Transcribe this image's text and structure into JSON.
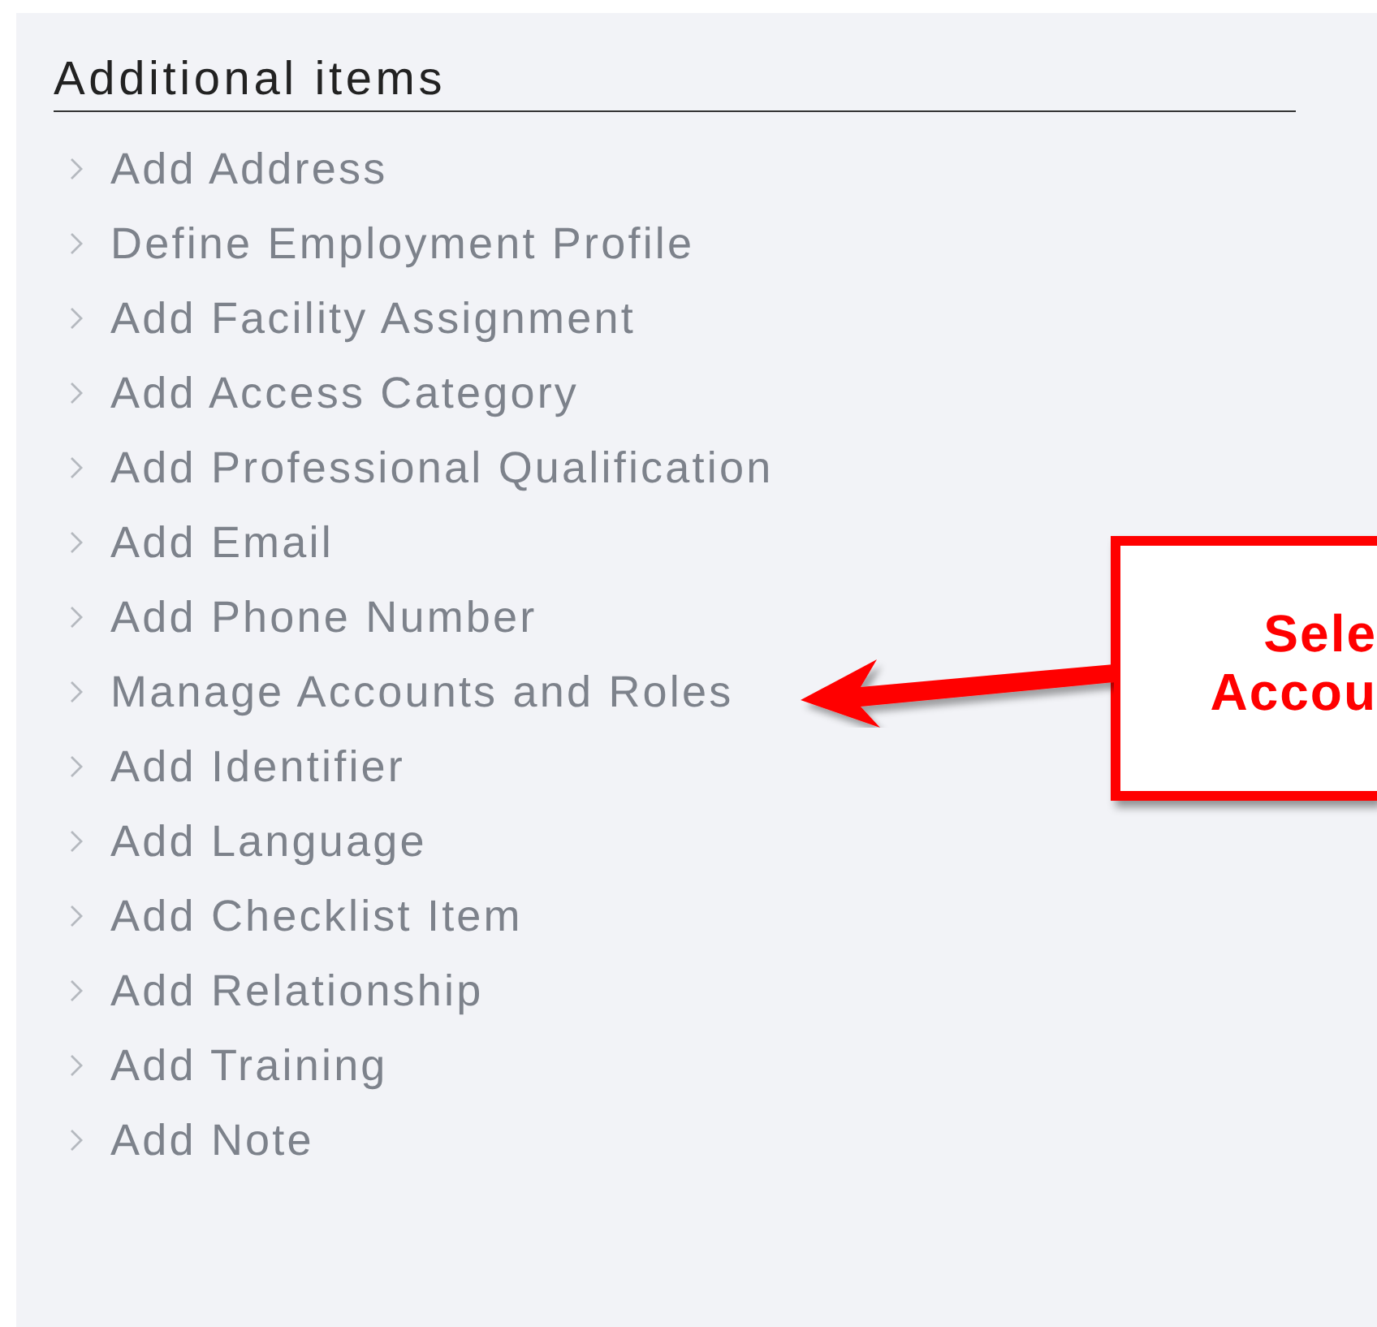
{
  "panel": {
    "title": "Additional items",
    "items": [
      {
        "label": "Add Address"
      },
      {
        "label": "Define Employment Profile"
      },
      {
        "label": "Add Facility Assignment"
      },
      {
        "label": "Add Access Category"
      },
      {
        "label": "Add Professional Qualification"
      },
      {
        "label": "Add Email"
      },
      {
        "label": "Add Phone Number"
      },
      {
        "label": "Manage Accounts and Roles"
      },
      {
        "label": "Add Identifier"
      },
      {
        "label": "Add Language"
      },
      {
        "label": "Add Checklist Item"
      },
      {
        "label": "Add Relationship"
      },
      {
        "label": "Add Training"
      },
      {
        "label": "Add Note"
      }
    ]
  },
  "callout": {
    "lines": [
      "Sele",
      "Accou"
    ]
  }
}
